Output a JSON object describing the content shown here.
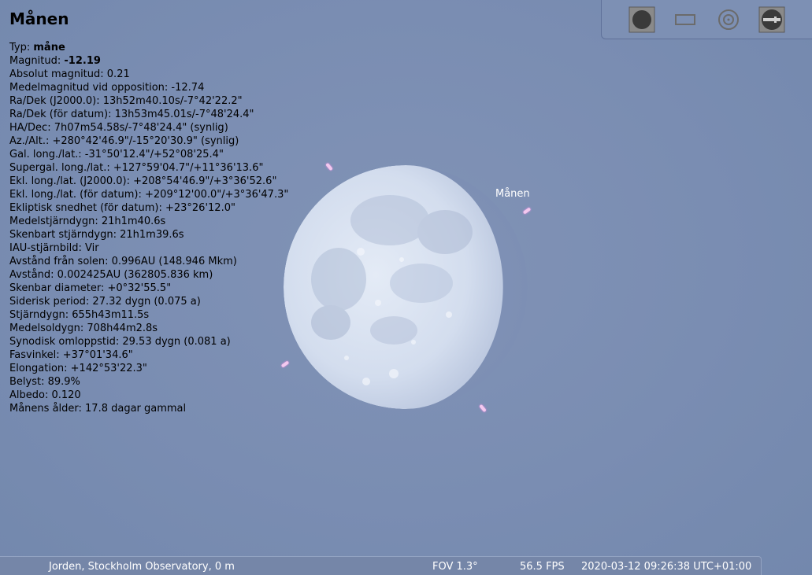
{
  "object": {
    "name": "Månen",
    "sky_label": "Månen"
  },
  "info": {
    "type": {
      "label": "Typ: ",
      "value": "måne"
    },
    "magnitude": {
      "label": "Magnitud: ",
      "value": "-12.19"
    },
    "lines": [
      "Absolut magnitud: 0.21",
      "Medelmagnitud vid opposition: -12.74",
      "Ra/Dek (J2000.0): 13h52m40.10s/-7°42'22.2\"",
      "Ra/Dek (för datum): 13h53m45.01s/-7°48'24.4\"",
      "HA/Dec: 7h07m54.58s/-7°48'24.4\" (synlig)",
      "Az./Alt.: +280°42'46.9\"/-15°20'30.9\" (synlig)",
      "Gal. long./lat.: -31°50'12.4\"/+52°08'25.4\"",
      "Supergal. long./lat.: +127°59'04.7\"/+11°36'13.6\"",
      "Ekl. long./lat. (J2000.0): +208°54'46.9\"/+3°36'52.6\"",
      "Ekl. long./lat. (för datum): +209°12'00.0\"/+3°36'47.3\"",
      "Ekliptisk snedhet (för datum): +23°26'12.0\"",
      "Medelstjärndygn: 21h1m40.6s",
      "Skenbart stjärndygn: 21h1m39.6s",
      "IAU-stjärnbild: Vir",
      "Avstånd från solen: 0.996AU (148.946 Mkm)",
      "Avstånd: 0.002425AU (362805.836 km)",
      "Skenbar diameter: +0°32'55.5\"",
      "Siderisk period: 27.32 dygn (0.075 a)",
      "Stjärndygn: 655h43m11.5s",
      "Medelsoldygn: 708h44m2.8s",
      "Synodisk omloppstid: 29.53 dygn (0.081 a)",
      "Fasvinkel: +37°01'34.6\"",
      "Elongation: +142°53'22.3\"",
      "Belyst: 89.9%",
      "Albedo: 0.120",
      "Månens ålder: 17.8 dagar gammal"
    ]
  },
  "illuminated_fraction": 0.899,
  "toolbar": {
    "buttons": [
      {
        "name": "planet-view-button",
        "icon": "filled-circle-icon"
      },
      {
        "name": "ocular-frame-button",
        "icon": "rectangle-frame-icon"
      },
      {
        "name": "target-ocular-button",
        "icon": "concentric-circles-icon"
      },
      {
        "name": "telescope-settings-button",
        "icon": "telescope-icon"
      }
    ]
  },
  "status": {
    "location": "Jorden, Stockholm Observatory, 0 m",
    "fov": "FOV 1.3°",
    "fps": "56.5 FPS",
    "datetime": "2020-03-12 09:26:38 UTC+01:00"
  },
  "colors": {
    "sky": "#7a8db2",
    "moon_lit": "#dde5f2",
    "marker": "#f3c9ee",
    "toolbar_icon": "#3a3a3a"
  }
}
